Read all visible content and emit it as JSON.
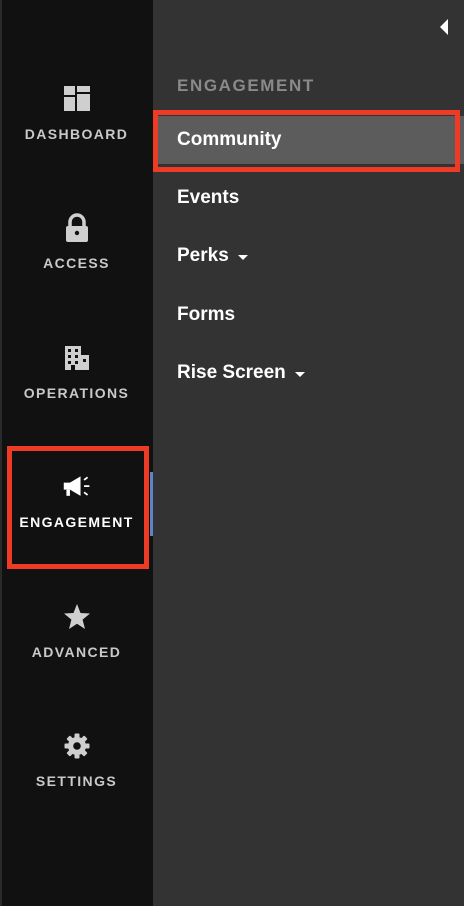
{
  "rail": {
    "items": [
      {
        "label": "DASHBOARD",
        "icon": "dashboard-icon"
      },
      {
        "label": "ACCESS",
        "icon": "lock-icon"
      },
      {
        "label": "OPERATIONS",
        "icon": "building-icon"
      },
      {
        "label": "ENGAGEMENT",
        "icon": "megaphone-icon",
        "active": true
      },
      {
        "label": "ADVANCED",
        "icon": "star-icon"
      },
      {
        "label": "SETTINGS",
        "icon": "gear-icon"
      }
    ]
  },
  "panel": {
    "section_title": "ENGAGEMENT",
    "items": [
      {
        "label": "Community",
        "selected": true
      },
      {
        "label": "Events"
      },
      {
        "label": "Perks",
        "has_dropdown": true
      },
      {
        "label": "Forms"
      },
      {
        "label": "Rise Screen",
        "has_dropdown": true
      }
    ]
  },
  "colors": {
    "rail_bg": "#111111",
    "panel_bg": "#333333",
    "selected_bg": "#5c5c5c",
    "highlight": "#ee3b25",
    "active_indicator": "#5a86c7"
  }
}
